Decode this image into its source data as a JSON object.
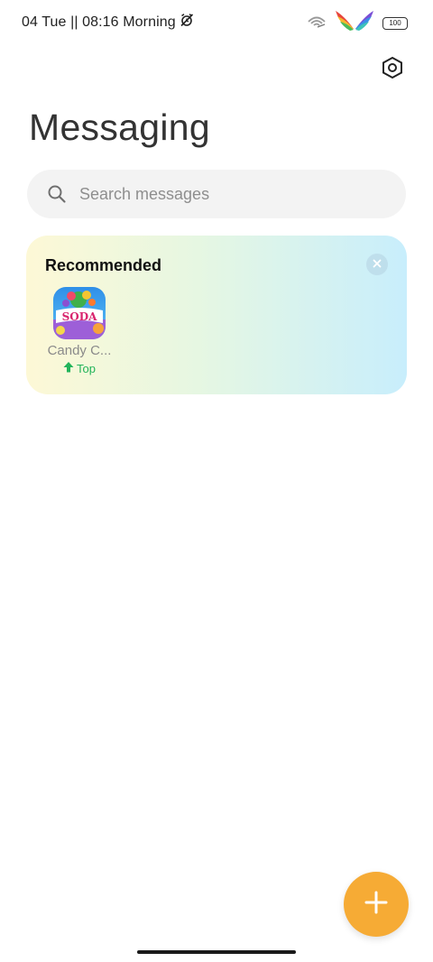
{
  "status_bar": {
    "time_text": "04 Tue || 08:16 Morning",
    "alarm_icon": "alarm-off-icon",
    "wifi_icon": "wifi-icon",
    "wings_icon": "rainbow-wings-icon",
    "battery_level": "100"
  },
  "header": {
    "settings_icon": "hexagon-settings-icon",
    "title": "Messaging"
  },
  "search": {
    "placeholder": "Search messages",
    "icon": "search-icon"
  },
  "recommended": {
    "title": "Recommended",
    "close_icon": "close-icon",
    "apps": [
      {
        "name": "Candy C...",
        "badge": "Top",
        "badge_icon": "arrow-up-icon",
        "icon": "candy-crush-soda-icon",
        "icon_text": "SODA"
      }
    ]
  },
  "fab": {
    "icon": "plus-icon",
    "color": "#f6ab35"
  },
  "colors": {
    "accent": "#f6ab35",
    "badge_green": "#22b45a"
  }
}
